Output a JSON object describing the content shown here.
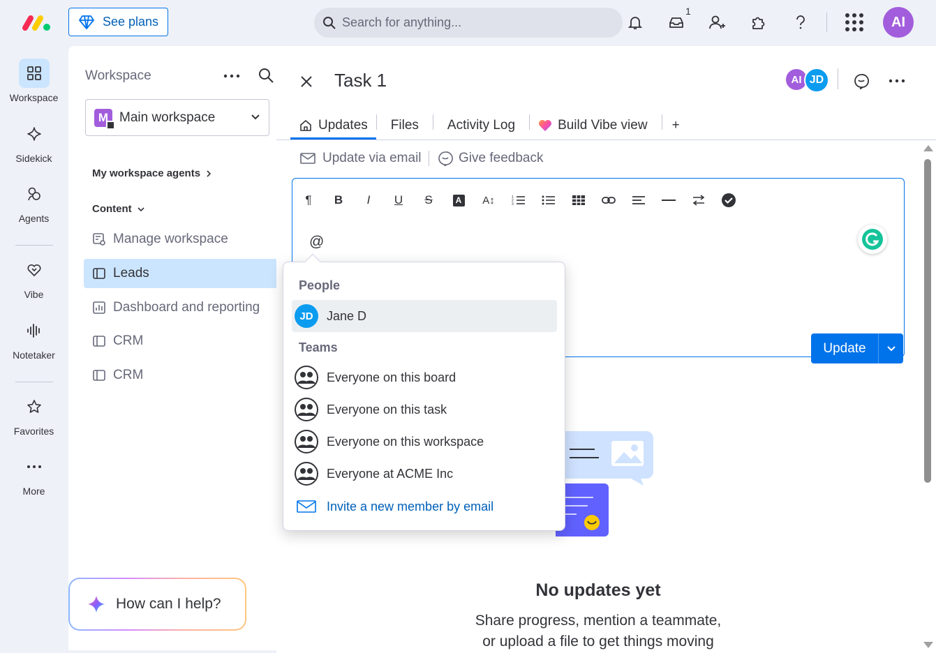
{
  "topbar": {
    "see_plans": "See plans",
    "search_placeholder": "Search for anything...",
    "inbox_badge": "1",
    "user_initials": "AI"
  },
  "rail": {
    "items": [
      {
        "label": "Workspace",
        "icon": "grid-icon"
      },
      {
        "label": "Sidekick",
        "icon": "sparkle-icon"
      },
      {
        "label": "Agents",
        "icon": "agents-icon"
      },
      {
        "label": "Vibe",
        "icon": "heart-icon"
      },
      {
        "label": "Notetaker",
        "icon": "waveform-icon"
      },
      {
        "label": "Favorites",
        "icon": "star-icon"
      },
      {
        "label": "More",
        "icon": "more-icon"
      }
    ]
  },
  "panel": {
    "title": "Workspace",
    "workspace_letter": "M",
    "workspace_name": "Main workspace",
    "agents_heading": "My workspace agents",
    "content_heading": "Content",
    "items": [
      {
        "label": "Manage workspace"
      },
      {
        "label": "Leads"
      },
      {
        "label": "Dashboard and reporting"
      },
      {
        "label": "CRM"
      },
      {
        "label": "CRM"
      }
    ]
  },
  "helper": {
    "label": "How can I help?"
  },
  "task": {
    "title": "Task 1",
    "member_initials": [
      "AI",
      "JD"
    ],
    "tabs": [
      "Updates",
      "Files",
      "Activity Log",
      "Build Vibe view"
    ],
    "add_tab": "+",
    "update_via_email": "Update via email",
    "give_feedback": "Give feedback"
  },
  "editor": {
    "content": "@",
    "update_label": "Update"
  },
  "mention_popup": {
    "people_heading": "People",
    "people": [
      {
        "initials": "JD",
        "name": "Jane D"
      }
    ],
    "teams_heading": "Teams",
    "teams": [
      "Everyone on this board",
      "Everyone on this task",
      "Everyone on this workspace",
      "Everyone at ACME Inc"
    ],
    "invite_label": "Invite a new member by email"
  },
  "empty_state": {
    "title": "No updates yet",
    "line1": "Share progress, mention a teammate,",
    "line2": "or upload a file to get things moving"
  },
  "colors": {
    "accent": "#0073ea",
    "brand_purple": "#a25ddc",
    "selection": "#cce5ff"
  }
}
